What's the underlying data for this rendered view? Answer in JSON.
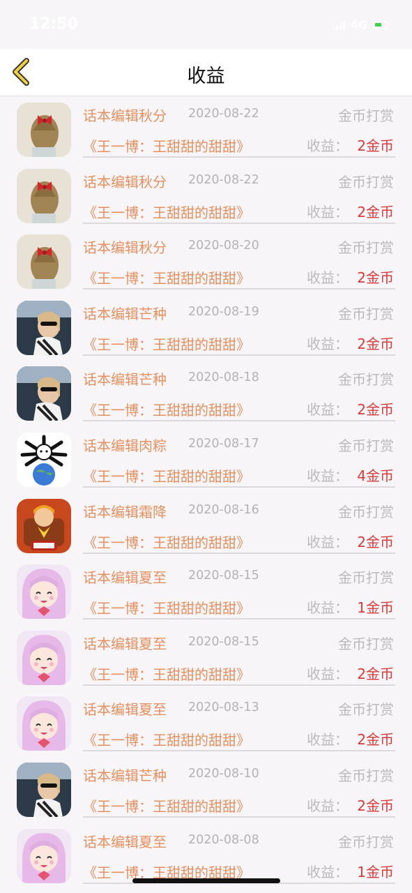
{
  "status_bar": {
    "time": "12:50",
    "network": "4G"
  },
  "nav": {
    "title": "收益",
    "back_icon": "chevron-left-icon"
  },
  "colors": {
    "accent": "#e6905f",
    "earn": "#d73a3a",
    "muted": "#bcb9bc"
  },
  "list": {
    "items": [
      {
        "avatar": "hair-bow-photo",
        "editor": "话本编辑秋分",
        "date": "2020-08-22",
        "type": "金币打赏",
        "book": "《王一博：王甜甜的甜甜》",
        "earn_label": "收益：",
        "earn_value": "2金币"
      },
      {
        "avatar": "hair-bow-photo",
        "editor": "话本编辑秋分",
        "date": "2020-08-22",
        "type": "金币打赏",
        "book": "《王一博：王甜甜的甜甜》",
        "earn_label": "收益：",
        "earn_value": "2金币"
      },
      {
        "avatar": "hair-bow-photo",
        "editor": "话本编辑秋分",
        "date": "2020-08-20",
        "type": "金币打赏",
        "book": "《王一博：王甜甜的甜甜》",
        "earn_label": "收益：",
        "earn_value": "2金币"
      },
      {
        "avatar": "car-selfie-photo",
        "editor": "话本编辑芒种",
        "date": "2020-08-19",
        "type": "金币打赏",
        "book": "《王一博：王甜甜的甜甜》",
        "earn_label": "收益：",
        "earn_value": "2金币"
      },
      {
        "avatar": "car-selfie-photo",
        "editor": "话本编辑芒种",
        "date": "2020-08-18",
        "type": "金币打赏",
        "book": "《王一博：王甜甜的甜甜》",
        "earn_label": "收益：",
        "earn_value": "2金币"
      },
      {
        "avatar": "cartoon-globe-image",
        "editor": "话本编辑肉粽",
        "date": "2020-08-17",
        "type": "金币打赏",
        "book": "《王一博：王甜甜的甜甜》",
        "earn_label": "收益：",
        "earn_value": "4金币"
      },
      {
        "avatar": "cartoon-character-image",
        "editor": "话本编辑霜降",
        "date": "2020-08-16",
        "type": "金币打赏",
        "book": "《王一博：王甜甜的甜甜》",
        "earn_label": "收益：",
        "earn_value": "2金币"
      },
      {
        "avatar": "anime-girl-image",
        "editor": "话本编辑夏至",
        "date": "2020-08-15",
        "type": "金币打赏",
        "book": "《王一博：王甜甜的甜甜》",
        "earn_label": "收益：",
        "earn_value": "1金币"
      },
      {
        "avatar": "anime-girl-image",
        "editor": "话本编辑夏至",
        "date": "2020-08-15",
        "type": "金币打赏",
        "book": "《王一博：王甜甜的甜甜》",
        "earn_label": "收益：",
        "earn_value": "2金币"
      },
      {
        "avatar": "anime-girl-image",
        "editor": "话本编辑夏至",
        "date": "2020-08-13",
        "type": "金币打赏",
        "book": "《王一博：王甜甜的甜甜》",
        "earn_label": "收益：",
        "earn_value": "2金币"
      },
      {
        "avatar": "car-selfie-photo",
        "editor": "话本编辑芒种",
        "date": "2020-08-10",
        "type": "金币打赏",
        "book": "《王一博：王甜甜的甜甜》",
        "earn_label": "收益：",
        "earn_value": "2金币"
      },
      {
        "avatar": "anime-girl-image",
        "editor": "话本编辑夏至",
        "date": "2020-08-08",
        "type": "金币打赏",
        "book": "《王一博：王甜甜的甜甜》",
        "earn_label": "收益：",
        "earn_value": "1金币"
      }
    ]
  }
}
